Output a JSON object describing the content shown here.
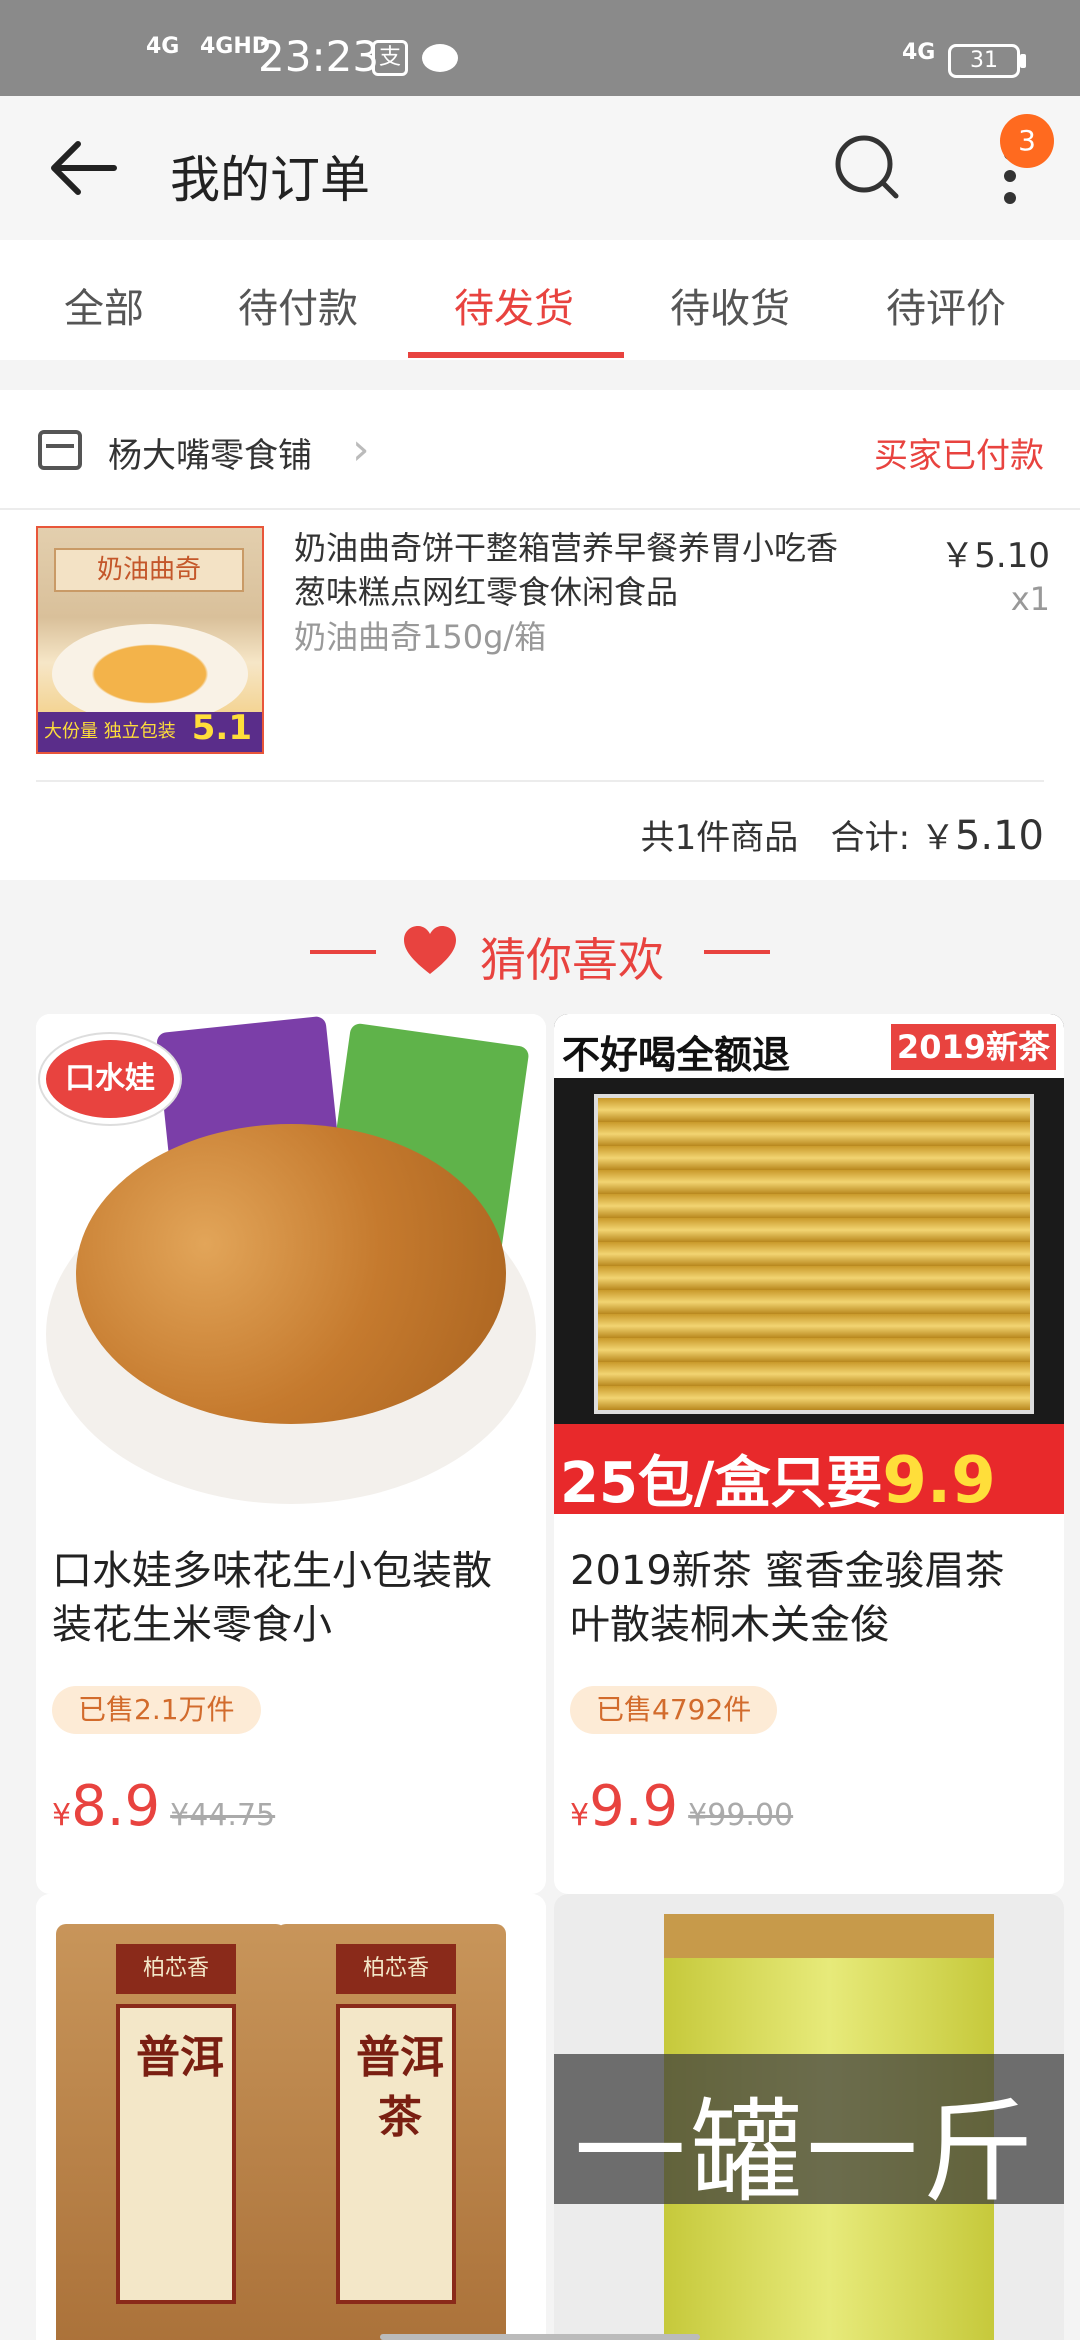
{
  "status_bar": {
    "signal_1": "4G",
    "signal_2": "4GHD",
    "time": "23:23",
    "app_icon": "支",
    "net_right": "4G",
    "battery": "31"
  },
  "header": {
    "title": "我的订单",
    "menu_badge": "3"
  },
  "tabs": [
    {
      "label": "全部"
    },
    {
      "label": "待付款"
    },
    {
      "label": "待发货"
    },
    {
      "label": "待收货"
    },
    {
      "label": "待评价"
    }
  ],
  "active_tab": "待发货",
  "order": {
    "shop_name": "杨大嘴零食铺",
    "status": "买家已付款",
    "thumb": {
      "box_title": "奶油曲奇",
      "promo": "大份量 独立包装",
      "price_tag": "5.1"
    },
    "product_title": "奶油曲奇饼干整箱营养早餐养胃小吃香葱味糕点网红零食休闲食品",
    "sku": "奶油曲奇150g/箱",
    "price": "￥5.10",
    "qty": "x1",
    "count_text": "共1件商品",
    "total_label": "合计: ￥",
    "total_amount": "5.10"
  },
  "recommend": {
    "title": "猜你喜欢",
    "items": [
      {
        "image_text": "口水娃",
        "title": "口水娃多味花生小包装散装花生米零食小",
        "sold": "已售2.1万件",
        "currency": "¥",
        "price": "8.9",
        "original_price": "¥44.75"
      },
      {
        "image_top_left": "不好喝全额退",
        "image_top_right": "2019新茶",
        "image_bottom": "25包/盒只要",
        "image_bottom_price": "9.9",
        "title": "2019新茶 蜜香金骏眉茶叶散装桐木关金俊",
        "sold": "已售4792件",
        "currency": "¥",
        "price": "9.9",
        "original_price": "¥99.00"
      },
      {
        "brand": "柏芯香",
        "label_left": "普洱",
        "label_right": "普洱茶"
      },
      {
        "band_text": "一罐一斤"
      }
    ]
  },
  "colors": {
    "accent": "#e8433f",
    "badge": "#ff6a1f",
    "sold_bg": "#fdebd6"
  }
}
